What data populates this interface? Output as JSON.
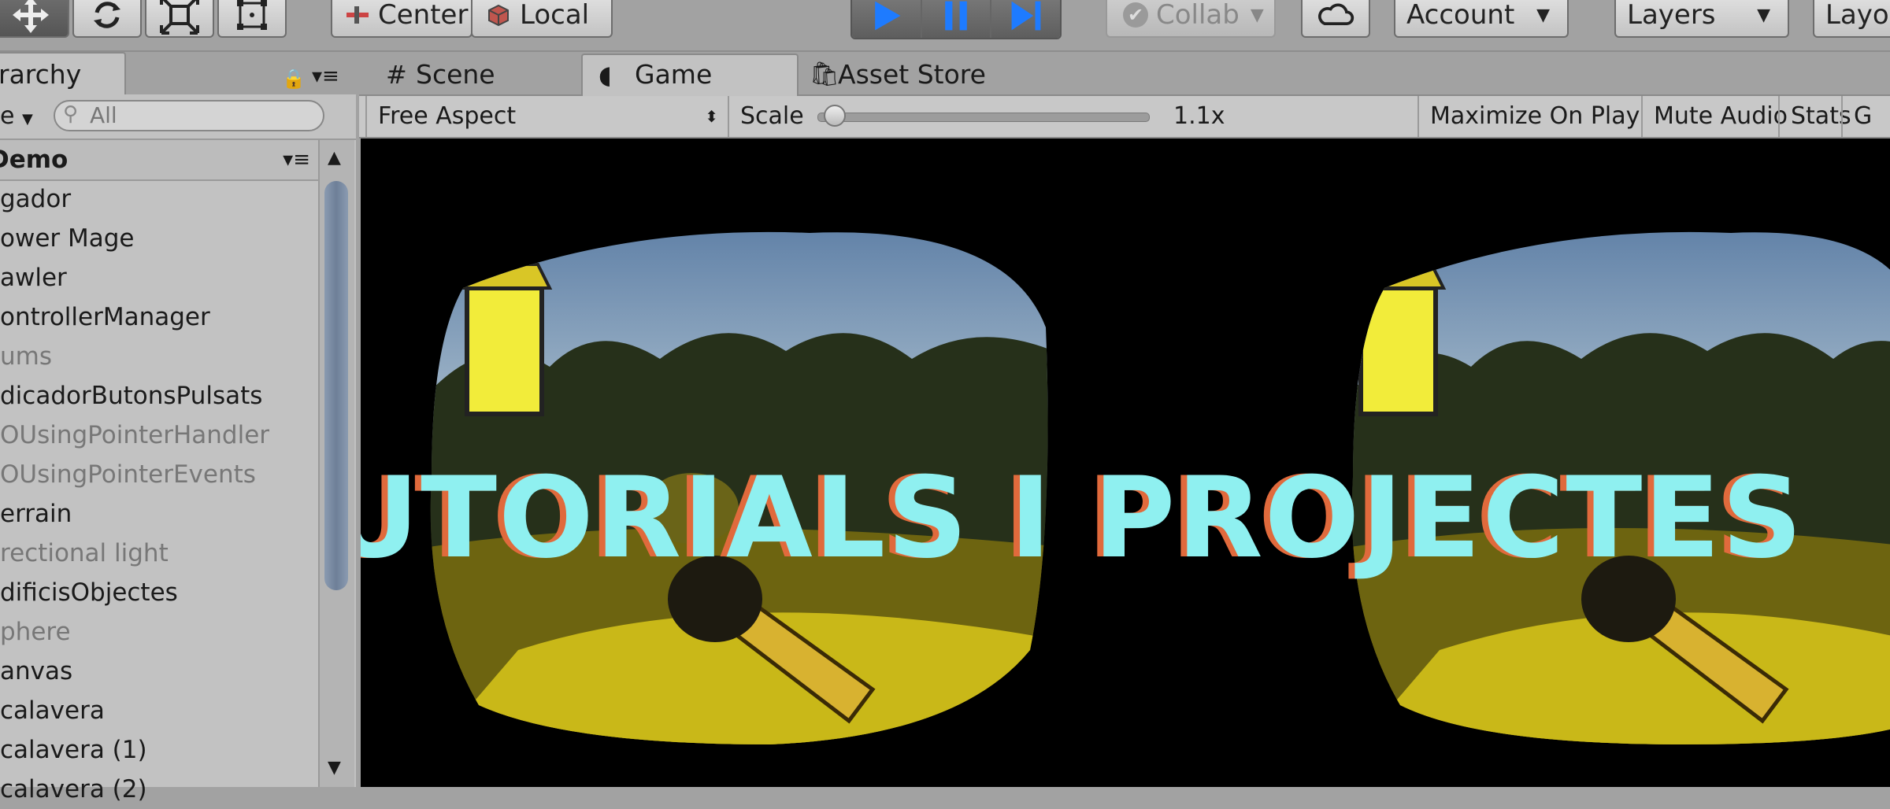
{
  "toolbar": {
    "tools": [
      {
        "icon": "move-tool-icon"
      },
      {
        "icon": "rotate-tool-icon"
      },
      {
        "icon": "scale-tool-icon"
      },
      {
        "icon": "rect-tool-icon"
      }
    ],
    "pivot_label": "Center",
    "space_label": "Local",
    "play_icon": "play-icon",
    "pause_icon": "pause-icon",
    "step_icon": "step-icon",
    "collab_label": "Collab",
    "cloud_icon": "cloud-icon",
    "account_label": "Account",
    "layers_label": "Layers",
    "layout_label": "Layou"
  },
  "hierarchy": {
    "tab_label": "rarchy",
    "create_label": "e",
    "search_placeholder": "All",
    "scene_name": "Demo",
    "items": [
      {
        "label": "gador",
        "dim": false
      },
      {
        "label": "ower Mage",
        "dim": false
      },
      {
        "label": "awler",
        "dim": false
      },
      {
        "label": "ontrollerManager",
        "dim": false
      },
      {
        "label": "ums",
        "dim": true
      },
      {
        "label": "dicadorButonsPulsats",
        "dim": false
      },
      {
        "label": "OUsingPointerHandler",
        "dim": true
      },
      {
        "label": "OUsingPointerEvents",
        "dim": true
      },
      {
        "label": "errain",
        "dim": false
      },
      {
        "label": "rectional light",
        "dim": true
      },
      {
        "label": "dificisObjectes",
        "dim": false
      },
      {
        "label": "phere",
        "dim": true
      },
      {
        "label": "anvas",
        "dim": false
      },
      {
        "label": "calavera",
        "dim": false
      },
      {
        "label": "calavera (1)",
        "dim": false
      },
      {
        "label": "calavera (2)",
        "dim": false
      }
    ]
  },
  "tabs": {
    "scene": "Scene",
    "game": "Game",
    "asset_store": "Asset Store"
  },
  "game_bar": {
    "aspect": "Free Aspect",
    "scale_label": "Scale",
    "scale_value": "1.1x",
    "scale_level": 0.05,
    "maximize": "Maximize On Play",
    "mute": "Mute Audio",
    "stats": "Stats",
    "gizmos": "G"
  },
  "overlay": {
    "title": "TUTORIALS I PROJECTES"
  },
  "colors": {
    "overlay_fill": "#8ff0f0",
    "overlay_shadow": "#e06a3c",
    "play_active": "#1e7bff"
  }
}
